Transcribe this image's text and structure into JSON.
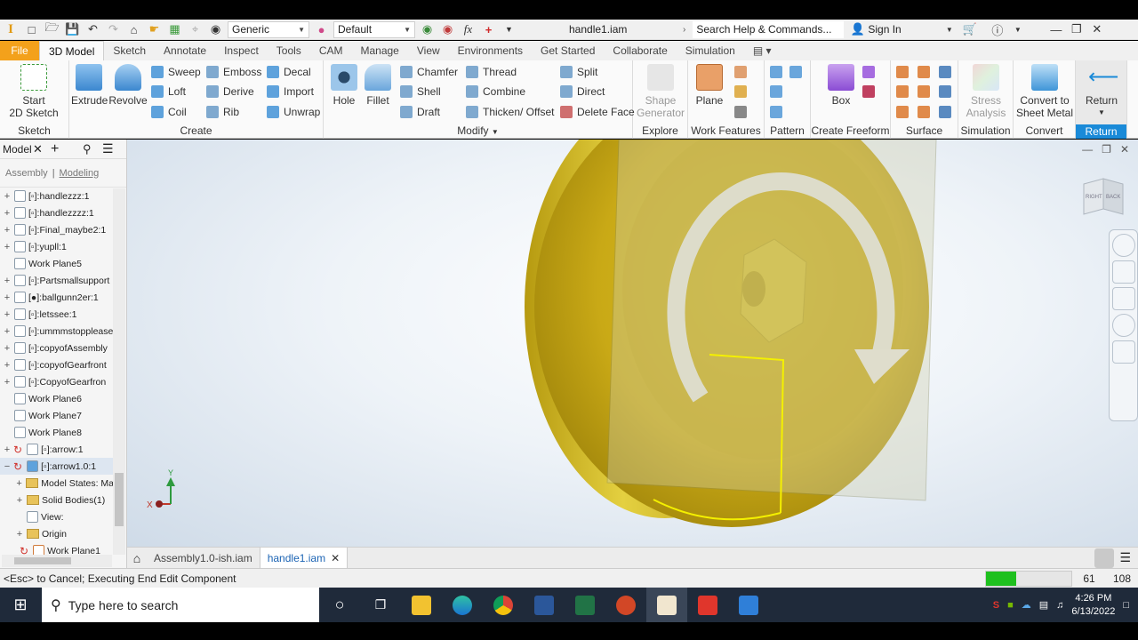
{
  "app": {
    "file_name": "handle1.iam",
    "search_placeholder": "Search Help & Commands...",
    "sign_in": "Sign In",
    "material_combo": "Generic",
    "appearance_combo": "Default"
  },
  "ribbon_tabs": [
    "File",
    "3D Model",
    "Sketch",
    "Annotate",
    "Inspect",
    "Tools",
    "CAM",
    "Manage",
    "View",
    "Environments",
    "Get Started",
    "Collaborate",
    "Simulation"
  ],
  "ribbon": {
    "sketch": {
      "start_line1": "Start",
      "start_line2": "2D Sketch",
      "label": "Sketch"
    },
    "create": {
      "extrude": "Extrude",
      "revolve": "Revolve",
      "sweep": "Sweep",
      "loft": "Loft",
      "coil": "Coil",
      "emboss": "Emboss",
      "derive": "Derive",
      "rib": "Rib",
      "decal": "Decal",
      "import": "Import",
      "unwrap": "Unwrap",
      "label": "Create"
    },
    "modify": {
      "hole": "Hole",
      "fillet": "Fillet",
      "chamfer": "Chamfer",
      "shell": "Shell",
      "draft": "Draft",
      "thread": "Thread",
      "combine": "Combine",
      "thicken": "Thicken/ Offset",
      "split": "Split",
      "direct": "Direct",
      "delete_face": "Delete Face",
      "label": "Modify"
    },
    "explore": {
      "shape_line1": "Shape",
      "shape_line2": "Generator",
      "label": "Explore"
    },
    "work_features": {
      "plane": "Plane",
      "label": "Work Features"
    },
    "pattern": {
      "label": "Pattern"
    },
    "freeform": {
      "box": "Box",
      "label": "Create Freeform"
    },
    "surface": {
      "label": "Surface"
    },
    "simulation": {
      "stress_line1": "Stress",
      "stress_line2": "Analysis",
      "label": "Simulation"
    },
    "convert": {
      "line1": "Convert to",
      "line2": "Sheet Metal",
      "label": "Convert"
    },
    "return": {
      "button": "Return",
      "label": "Return"
    }
  },
  "browser": {
    "title": "Model",
    "tab_assembly": "Assembly",
    "tab_modeling": "Modeling",
    "nodes": [
      "[▫]:handlezzz:1",
      "[▫]:handlezzzz:1",
      "[▫]:Final_maybe2:1",
      "[▫]:yupll:1",
      "Work Plane5",
      "[▫]:Partsmallsupport",
      "[●]:ballgunn2er:1",
      "[▫]:letssee:1",
      "[▫]:ummmstopplease",
      "[▫]:copyofAssembly",
      "[▫]:copyofGearfront",
      "[▫]:CopyofGearfron",
      "Work Plane6",
      "Work Plane7",
      "Work Plane8",
      "[▫]:arrow:1",
      "[▫]:arrow1.0:1",
      "Model States: Ma",
      "Solid Bodies(1)",
      "View:",
      "Origin",
      "Work Plane1"
    ]
  },
  "viewcube": {
    "right": "RIGHT",
    "back": "BACK"
  },
  "axes": {
    "x": "X",
    "y": "Y"
  },
  "doc_tabs": {
    "tab1": "Assembly1.0-ish.iam",
    "tab2": "handle1.iam"
  },
  "status": {
    "message": "<Esc> to Cancel; Executing End Edit Component",
    "num1": "61",
    "num2": "108",
    "progress": 0.35
  },
  "taskbar": {
    "search": "Type here to search",
    "time": "4:26 PM",
    "date": "6/13/2022"
  },
  "colors": {
    "file_tab": "#f3a11b",
    "part_yellow": "#d9c21a",
    "return_blue": "#1a8ad8",
    "taskbar": "#1f2a3a"
  }
}
